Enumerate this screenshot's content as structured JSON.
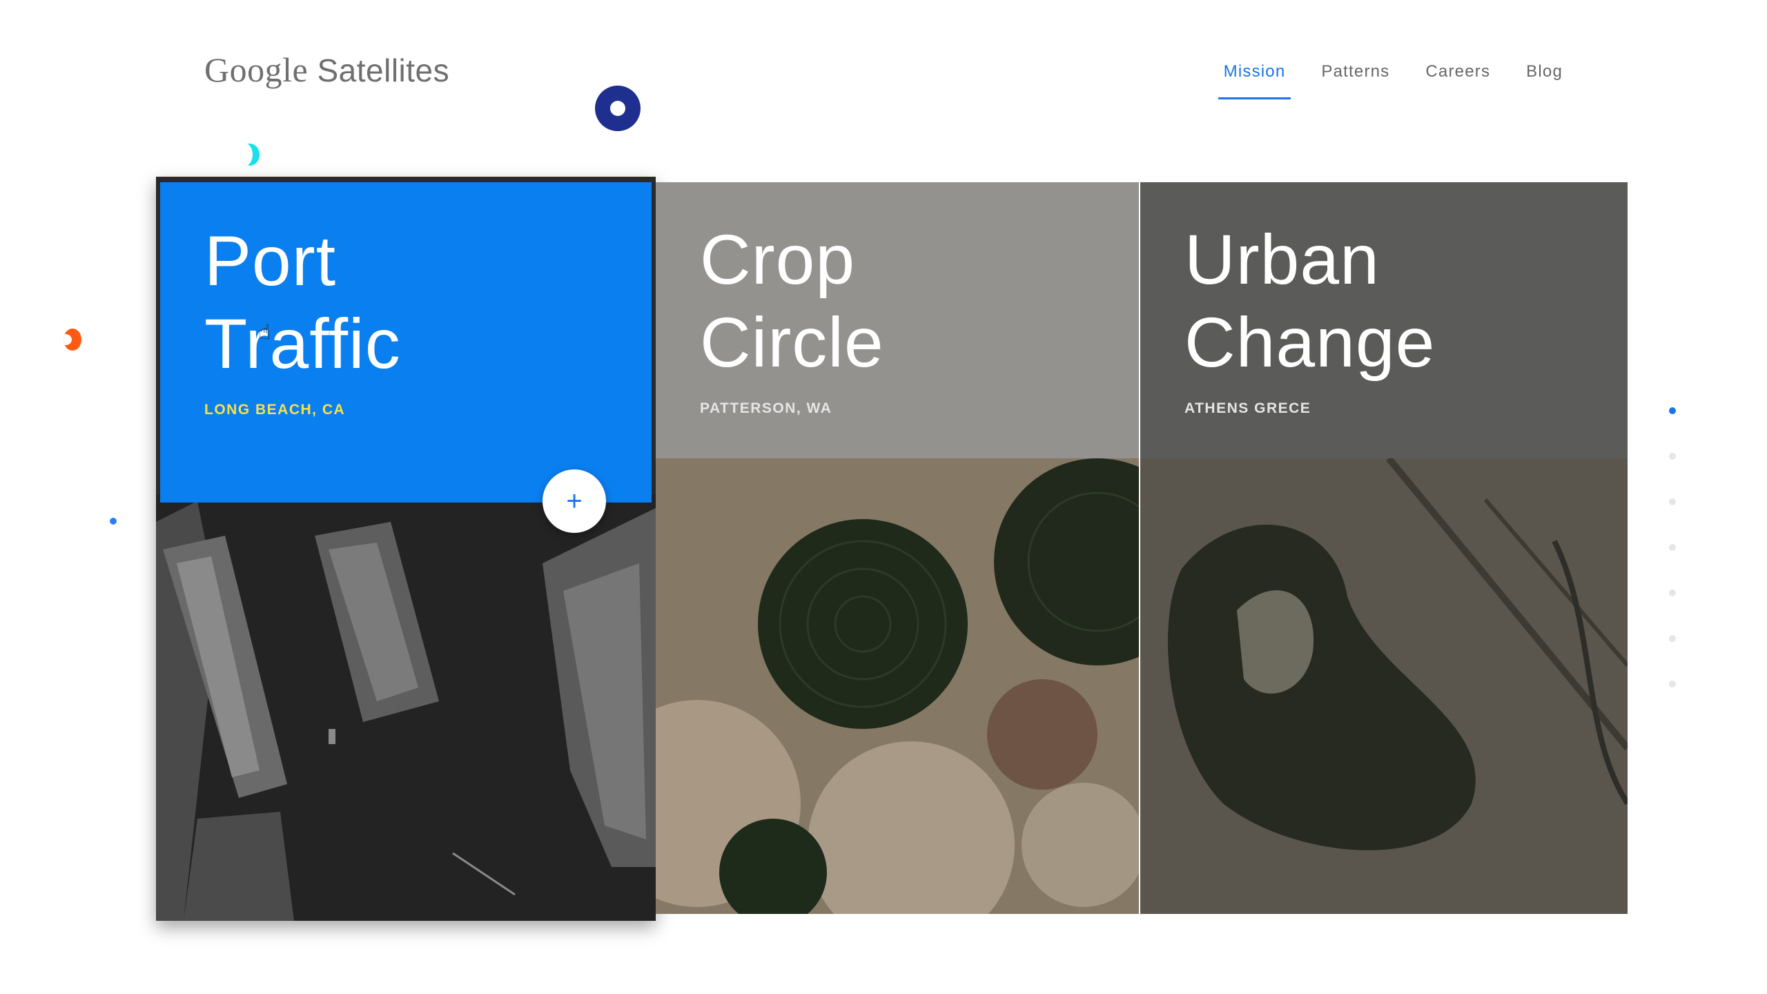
{
  "header": {
    "brand_google": "Google",
    "brand_product": "Satellites",
    "nav": [
      {
        "label": "Mission",
        "active": true
      },
      {
        "label": "Patterns",
        "active": false
      },
      {
        "label": "Careers",
        "active": false
      },
      {
        "label": "Blog",
        "active": false
      }
    ]
  },
  "cards": [
    {
      "title_line1": "Port",
      "title_line2": "Traffic",
      "location": "LONG BEACH, CA",
      "overlay_color": "#0a7ff0",
      "location_color": "#f7e24a"
    },
    {
      "title_line1": "Crop",
      "title_line2": "Circle",
      "location": "PATTERSON, WA"
    },
    {
      "title_line1": "Urban",
      "title_line2": "Change",
      "location": "ATHENS GRECE"
    }
  ],
  "expand_button": {
    "icon": "plus-icon",
    "symbol": "+"
  },
  "pager": {
    "count": 7,
    "active_index": 0
  },
  "colors": {
    "accent": "#1a73e8",
    "ring": "#1f2f8f",
    "cyan": "#19e0ea",
    "orange": "#ff5a14"
  }
}
